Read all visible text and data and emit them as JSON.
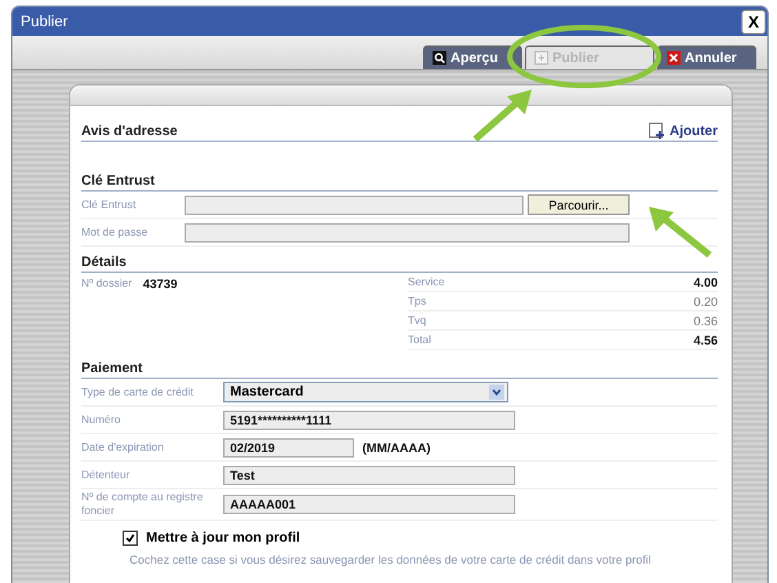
{
  "window": {
    "title": "Publier",
    "close": "X"
  },
  "toolbar": [
    {
      "kind": "preview",
      "label": "Aperçu",
      "disabled": false
    },
    {
      "kind": "publish",
      "label": "Publier",
      "disabled": true
    },
    {
      "kind": "cancel",
      "label": "Annuler",
      "disabled": false
    }
  ],
  "address": {
    "title": "Avis d'adresse",
    "add": "Ajouter"
  },
  "entrust": {
    "title": "Clé Entrust",
    "key_label": "Clé Entrust",
    "browse": "Parcourir...",
    "password_label": "Mot de passe"
  },
  "details": {
    "title": "Détails",
    "file_label": "Nº dossier",
    "file_value": "43739",
    "fees": [
      {
        "label": "Service",
        "value": "4.00",
        "bold": true
      },
      {
        "label": "Tps",
        "value": "0.20",
        "bold": false
      },
      {
        "label": "Tvq",
        "value": "0.36",
        "bold": false
      },
      {
        "label": "Total",
        "value": "4.56",
        "bold": true
      }
    ]
  },
  "payment": {
    "title": "Paiement",
    "fields": [
      {
        "kind": "select",
        "label": "Type de carte de crédit",
        "value": "Mastercard"
      },
      {
        "kind": "input",
        "label": "Numéro",
        "value": "5191**********1111"
      },
      {
        "kind": "date",
        "label": "Date d'expiration",
        "value": "02/2019",
        "hint": "(MM/AAAA)"
      },
      {
        "kind": "input",
        "label": "Détenteur",
        "value": "Test"
      },
      {
        "kind": "input",
        "label": "Nº de compte au registre foncier",
        "value": "AAAAA001"
      }
    ],
    "update_profile": {
      "label": "Mettre à jour mon profil",
      "checked": true,
      "help": "Cochez cette case si vous désirez sauvegarder les données de votre carte de crédit dans votre profil"
    }
  },
  "annotations": [
    {
      "kind": "ellipse"
    },
    {
      "kind": "arrow"
    },
    {
      "kind": "arrow"
    }
  ]
}
